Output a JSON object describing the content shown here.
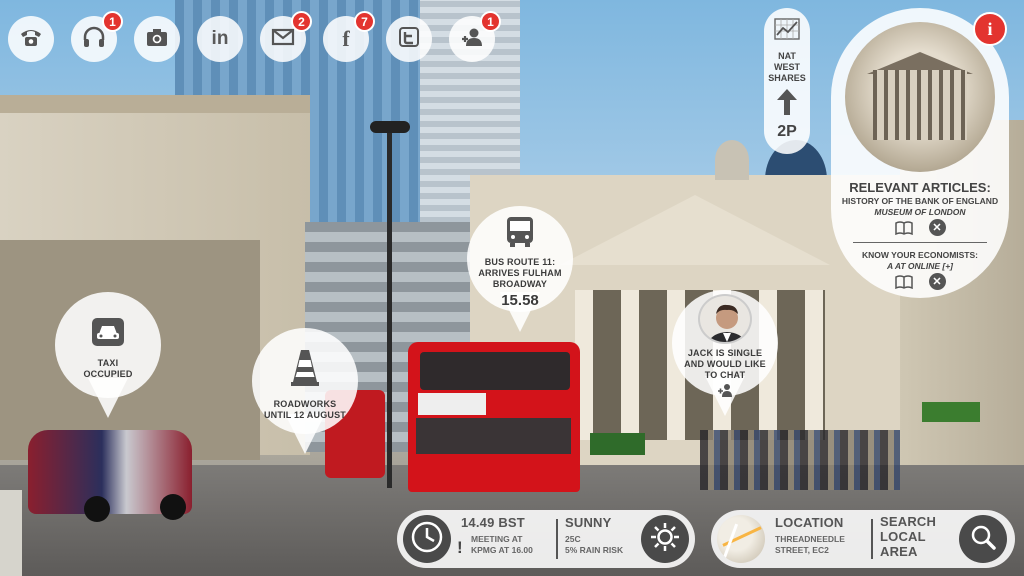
{
  "top_bar": [
    {
      "name": "phone-icon",
      "badge": ""
    },
    {
      "name": "headphones-icon",
      "badge": "1"
    },
    {
      "name": "camera-icon",
      "badge": ""
    },
    {
      "name": "linkedin-icon",
      "glyph": "in",
      "badge": ""
    },
    {
      "name": "mail-icon",
      "badge": "2"
    },
    {
      "name": "facebook-icon",
      "glyph": "f",
      "badge": "7"
    },
    {
      "name": "twitter-icon",
      "badge": ""
    },
    {
      "name": "add-contact-icon",
      "badge": "1"
    }
  ],
  "pins": {
    "taxi": {
      "icon": "car-icon",
      "line1": "TAXI",
      "line2": "OCCUPIED"
    },
    "roadworks": {
      "icon": "traffic-cone-icon",
      "line1": "ROADWORKS",
      "line2": "UNTIL 12 AUGUST"
    },
    "bus": {
      "icon": "bus-icon",
      "line1": "BUS ROUTE 11:",
      "line2": "ARRIVES FULHAM",
      "line3": "BROADWAY",
      "time": "15.58"
    },
    "contact": {
      "icon": "person-avatar",
      "line1": "JACK IS SINGLE",
      "line2": "AND WOULD LIKE",
      "line3": "TO CHAT",
      "action_icon": "add-contact-icon"
    }
  },
  "share": {
    "icon": "chart-icon",
    "line1": "NAT",
    "line2": "WEST",
    "line3": "SHARES",
    "arrow": "up-arrow-icon",
    "value": "2P"
  },
  "articles": {
    "title": "RELEVANT ARTICLES:",
    "item1": {
      "line1": "HISTORY OF THE BANK OF ENGLAND",
      "line2": "MUSEUM OF LONDON"
    },
    "item2": {
      "line1": "KNOW YOUR ECONOMISTS:",
      "line2": "A AT ONLINE [+]"
    }
  },
  "info_button": "i",
  "bottom": {
    "time": "14.49 BST",
    "meeting_l1": "MEETING AT",
    "meeting_l2": "KPMG AT 16.00",
    "alert": "!",
    "weather_title": "SUNNY",
    "weather_l1": "25C",
    "weather_l2": "5% RAIN RISK",
    "location_title": "LOCATION",
    "location_l1": "THREADNEEDLE",
    "location_l2": "STREET, EC2",
    "search_l1": "SEARCH",
    "search_l2": "LOCAL",
    "search_l3": "AREA"
  },
  "colors": {
    "badge": "#e3342f",
    "panel": "#ffffff",
    "dark_icon": "#4a4a4a"
  }
}
